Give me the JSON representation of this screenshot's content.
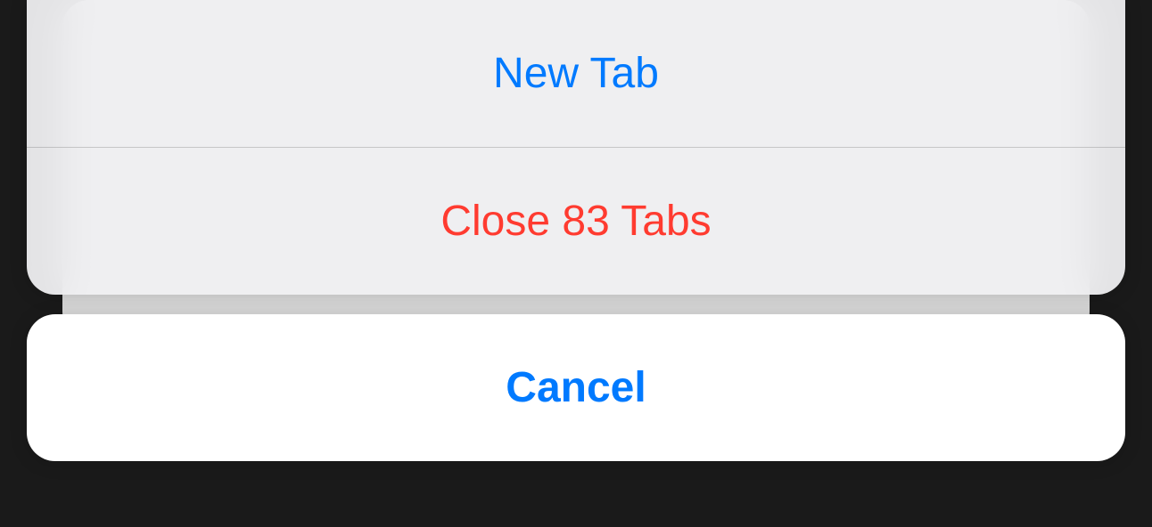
{
  "actionSheet": {
    "newTabLabel": "New Tab",
    "closeTabsLabel": "Close 83 Tabs",
    "cancelLabel": "Cancel"
  }
}
